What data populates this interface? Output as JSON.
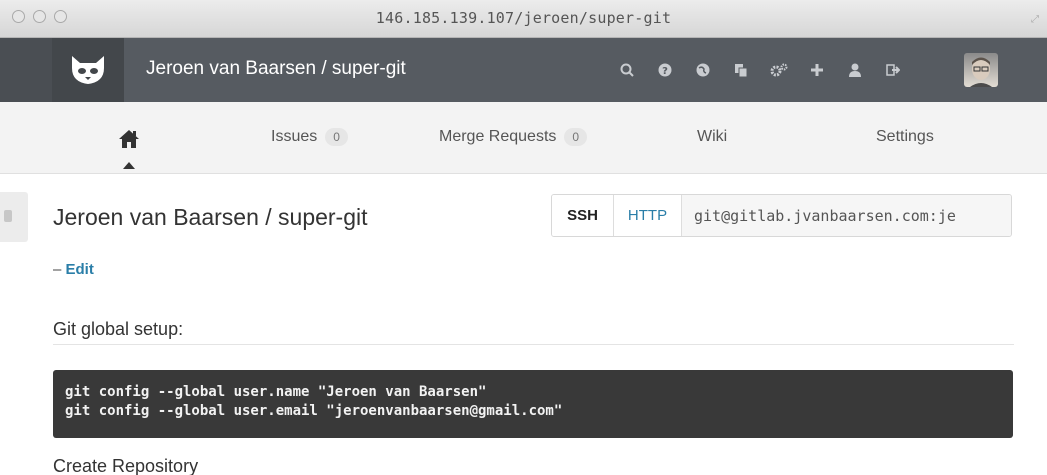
{
  "window": {
    "title": "146.185.139.107/jeroen/super-git"
  },
  "navbar": {
    "project_title": "Jeroen van Baarsen / super-git",
    "icons": [
      "search-icon",
      "help-icon",
      "globe-icon",
      "copy-icon",
      "cogs-icon",
      "plus-icon",
      "user-icon",
      "logout-icon"
    ]
  },
  "subnav": {
    "items": [
      {
        "label": "Issues",
        "count": "0"
      },
      {
        "label": "Merge Requests",
        "count": "0"
      },
      {
        "label": "Wiki"
      },
      {
        "label": "Settings"
      }
    ]
  },
  "main": {
    "title": "Jeroen van Baarsen / super-git",
    "edit_prefix": "– ",
    "edit_label": "Edit",
    "clone": {
      "ssh_label": "SSH",
      "http_label": "HTTP",
      "url": "git@gitlab.jvanbaarsen.com:je"
    },
    "global_setup_title": "Git global setup:",
    "code_lines": [
      "git config --global user.name \"Jeroen van Baarsen\"",
      "git config --global user.email \"jeroenvanbaarsen@gmail.com\""
    ],
    "create_repo_title": "Create Repository"
  },
  "colors": {
    "navbar_bg": "#565b61",
    "accent_link": "#2a7ea8",
    "code_bg": "#393939"
  }
}
